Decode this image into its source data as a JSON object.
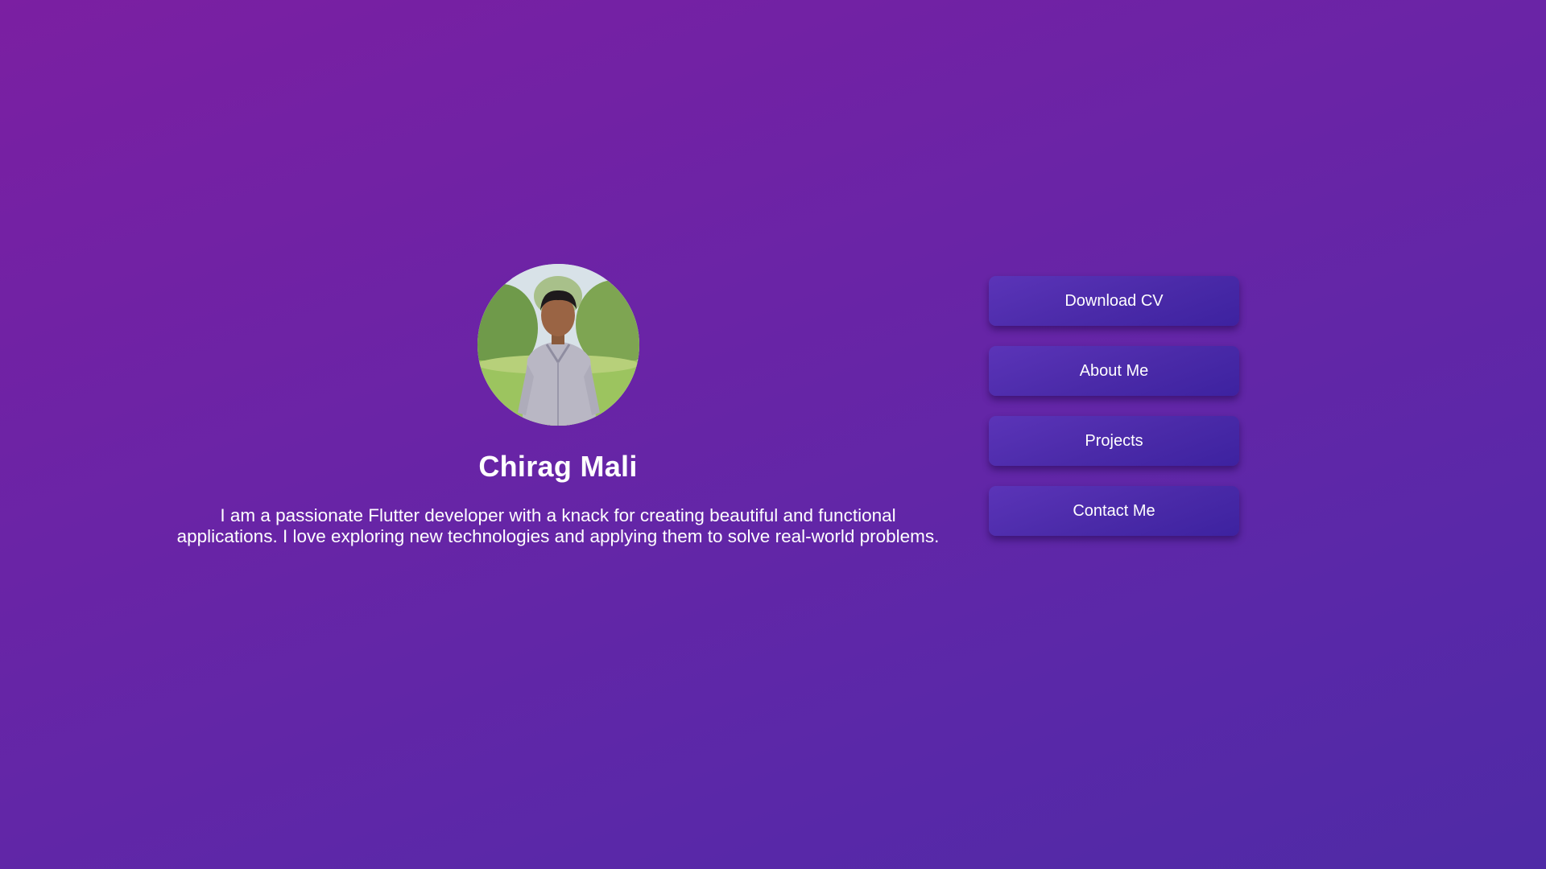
{
  "profile": {
    "avatar_alt": "Profile photo",
    "name": "Chirag Mali",
    "bio": "I am a passionate Flutter developer with a knack for creating beautiful and functional applications. I love exploring new technologies and applying them to solve real-world problems."
  },
  "actions": {
    "download_cv_label": "Download CV",
    "about_me_label": "About Me",
    "projects_label": "Projects",
    "contact_me_label": "Contact Me"
  },
  "colors": {
    "background_start": "#7b1fa2",
    "background_end": "#4f2aa6",
    "button": "#4a2aa8",
    "text": "#ffffff"
  }
}
